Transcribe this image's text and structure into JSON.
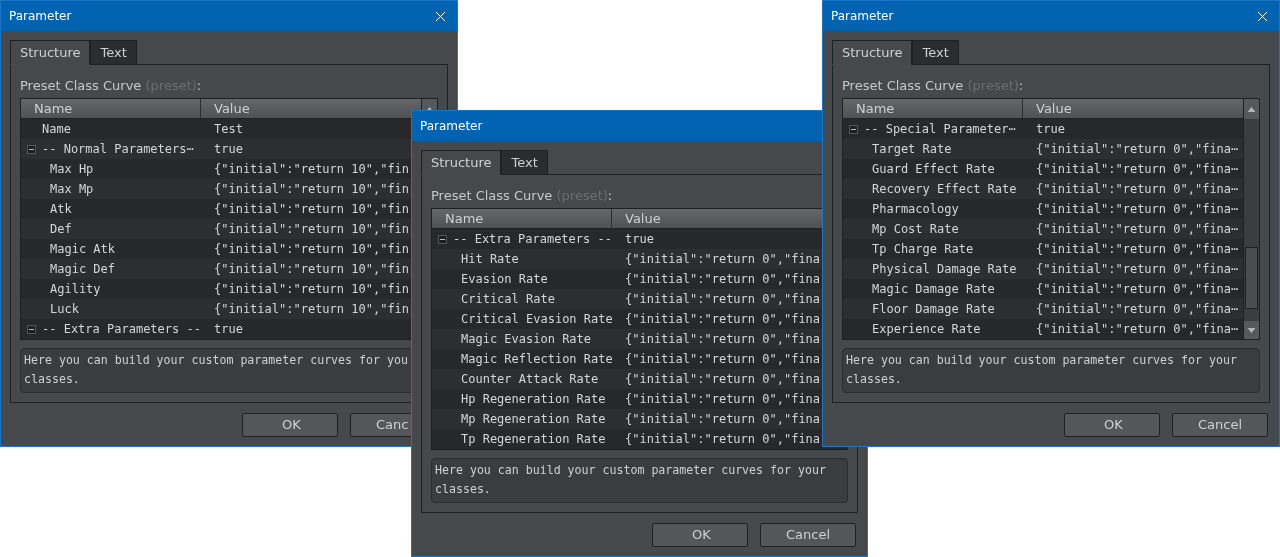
{
  "windows": [
    {
      "title": "Parameter",
      "closable": true,
      "scrollbar": true,
      "scrollbar_lower_part": false,
      "tabs": [
        {
          "label": "Structure",
          "selected": true
        },
        {
          "label": "Text",
          "selected": false
        }
      ],
      "field_label": {
        "text": "Preset Class Curve",
        "hint": "(preset)",
        "suffix": ":"
      },
      "columns": [
        "Name",
        "Value"
      ],
      "tree": [
        {
          "name": "Name",
          "value": "Test"
        },
        {
          "name": "-- Normal Parameters⋯",
          "value": "true",
          "expanded": true,
          "children": [
            {
              "name": "Max Hp",
              "value": "{\"initial\":\"return 10\",\"fin"
            },
            {
              "name": "Max Mp",
              "value": "{\"initial\":\"return 10\",\"fin"
            },
            {
              "name": "Atk",
              "value": "{\"initial\":\"return 10\",\"fin"
            },
            {
              "name": "Def",
              "value": "{\"initial\":\"return 10\",\"fin"
            },
            {
              "name": "Magic Atk",
              "value": "{\"initial\":\"return 10\",\"fin"
            },
            {
              "name": "Magic Def",
              "value": "{\"initial\":\"return 10\",\"fin"
            },
            {
              "name": "Agility",
              "value": "{\"initial\":\"return 10\",\"fin"
            },
            {
              "name": "Luck",
              "value": "{\"initial\":\"return 10\",\"fin"
            }
          ]
        },
        {
          "name": "-- Extra Parameters --",
          "value": "true",
          "expanded": true
        }
      ],
      "description": [
        "Here you can build your custom parameter curves for you",
        "classes."
      ],
      "buttons": [
        "OK",
        "Canc"
      ]
    },
    {
      "title": "Parameter",
      "closable": false,
      "scrollbar": false,
      "tabs": [
        {
          "label": "Structure",
          "selected": true
        },
        {
          "label": "Text",
          "selected": false
        }
      ],
      "field_label": {
        "text": "Preset Class Curve",
        "hint": "(preset)",
        "suffix": ":"
      },
      "columns": [
        "Name",
        "Value"
      ],
      "tree": [
        {
          "name": "-- Extra Parameters --",
          "value": "true",
          "expanded": true,
          "children": [
            {
              "name": "Hit Rate",
              "value": "{\"initial\":\"return 0\",\"fina"
            },
            {
              "name": "Evasion Rate",
              "value": "{\"initial\":\"return 0\",\"fina"
            },
            {
              "name": "Critical Rate",
              "value": "{\"initial\":\"return 0\",\"fina"
            },
            {
              "name": "Critical Evasion Rate",
              "value": "{\"initial\":\"return 0\",\"fina"
            },
            {
              "name": "Magic Evasion Rate",
              "value": "{\"initial\":\"return 0\",\"fina"
            },
            {
              "name": "Magic Reflection Rate",
              "value": "{\"initial\":\"return 0\",\"fina"
            },
            {
              "name": "Counter Attack Rate",
              "value": "{\"initial\":\"return 0\",\"fina"
            },
            {
              "name": "Hp Regeneration Rate",
              "value": "{\"initial\":\"return 0\",\"fina"
            },
            {
              "name": "Mp Regeneration Rate",
              "value": "{\"initial\":\"return 0\",\"fina"
            },
            {
              "name": "Tp Regeneration Rate",
              "value": "{\"initial\":\"return 0\",\"fina"
            }
          ]
        }
      ],
      "description": [
        "Here you can build your custom parameter curves for your",
        "classes."
      ],
      "buttons": [
        "OK",
        "Cancel"
      ]
    },
    {
      "title": "Parameter",
      "closable": true,
      "scrollbar": true,
      "scrollbar_lower_part": true,
      "tabs": [
        {
          "label": "Structure",
          "selected": true
        },
        {
          "label": "Text",
          "selected": false
        }
      ],
      "field_label": {
        "text": "Preset Class Curve",
        "hint": "(preset)",
        "suffix": ":"
      },
      "columns": [
        "Name",
        "Value"
      ],
      "tree": [
        {
          "name": "-- Special Parameter⋯",
          "value": "true",
          "expanded": true,
          "children": [
            {
              "name": "Target Rate",
              "value": "{\"initial\":\"return 0\",\"fina⋯"
            },
            {
              "name": "Guard Effect Rate",
              "value": "{\"initial\":\"return 0\",\"fina⋯"
            },
            {
              "name": "Recovery Effect Rate",
              "value": "{\"initial\":\"return 0\",\"fina⋯"
            },
            {
              "name": "Pharmacology",
              "value": "{\"initial\":\"return 0\",\"fina⋯"
            },
            {
              "name": "Mp Cost Rate",
              "value": "{\"initial\":\"return 0\",\"fina⋯"
            },
            {
              "name": "Tp Charge Rate",
              "value": "{\"initial\":\"return 0\",\"fina⋯"
            },
            {
              "name": "Physical Damage Rate",
              "value": "{\"initial\":\"return 0\",\"fina⋯"
            },
            {
              "name": "Magic Damage Rate",
              "value": "{\"initial\":\"return 0\",\"fina⋯"
            },
            {
              "name": "Floor Damage Rate",
              "value": "{\"initial\":\"return 0\",\"fina⋯"
            },
            {
              "name": "Experience Rate",
              "value": "{\"initial\":\"return 0\",\"fina⋯"
            }
          ]
        }
      ],
      "description": [
        "Here you can build your custom parameter curves for your",
        "classes."
      ],
      "buttons": [
        "OK",
        "Cancel"
      ]
    }
  ]
}
